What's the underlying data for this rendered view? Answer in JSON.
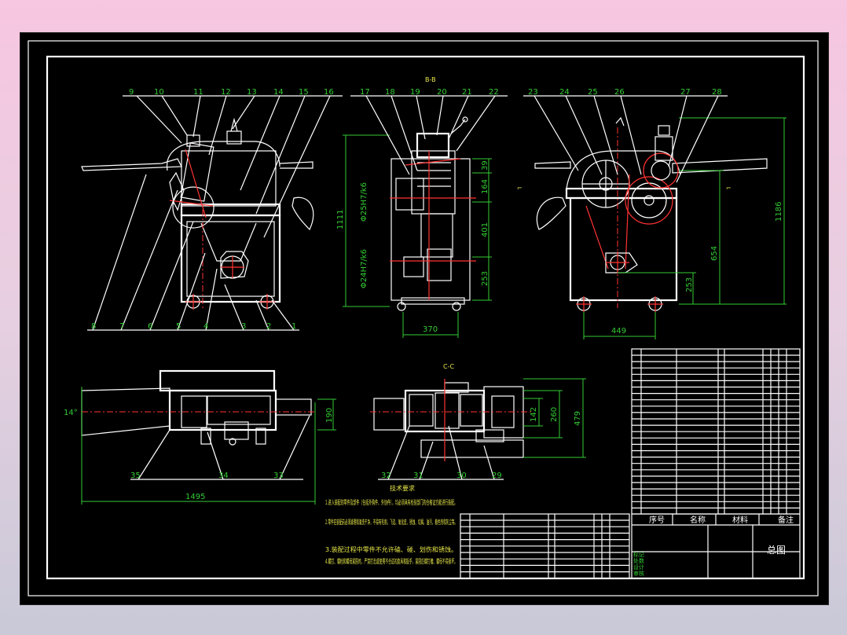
{
  "drawing": {
    "part_numbers_top": [
      "9",
      "10",
      "11",
      "12",
      "13",
      "14",
      "15",
      "16",
      "17",
      "18",
      "19",
      "20",
      "21",
      "22",
      "23",
      "24",
      "25",
      "26",
      "27",
      "28"
    ],
    "part_numbers_bottom": [
      "8",
      "7",
      "6",
      "5",
      "4",
      "3",
      "2",
      "1"
    ],
    "part_numbers_plan": [
      "35",
      "34",
      "33",
      "32",
      "31",
      "30",
      "29"
    ],
    "view_label_top": "B-B",
    "view_label_section": "C-C",
    "dims": {
      "height_left": "1111",
      "d_upper": "Φ25H7/k6",
      "d_lower": "Φ24H7/k6",
      "v39": "39",
      "v164": "164",
      "v401": "401",
      "v253": "253",
      "w370": "370",
      "h1186": "1186",
      "v654": "654",
      "v253b": "253",
      "w449": "449",
      "angle14": "14°",
      "h190": "190",
      "w1495": "1495",
      "h142": "142",
      "h260": "260",
      "h479": "479"
    },
    "tech_title": "技术要求",
    "tech_notes": [
      "1.进入装配的零件及部件（包括外购件、外协件），均必须具有检验部门的合格证方能进行装配。",
      "2.零件在装配前必须清理和清洗干净，不得有毛刺、飞边、氧化皮、锈蚀、切屑、油污、着色剂和灰尘等。",
      "3.装配过程中零件不允许磕、碰、划伤和锈蚀。",
      "4.螺钉、螺栓和螺母紧固时，严禁打击或使用不合适的旋具和扳手，紧固后螺钉槽、螺母不得损坏。"
    ],
    "title_block": {
      "name": "总图",
      "col_headers": [
        "序号",
        "名称",
        "材料",
        "备注"
      ],
      "row_labels": [
        "标记",
        "处数",
        "分区",
        "设计",
        "审核",
        "工艺",
        "批准"
      ]
    }
  }
}
